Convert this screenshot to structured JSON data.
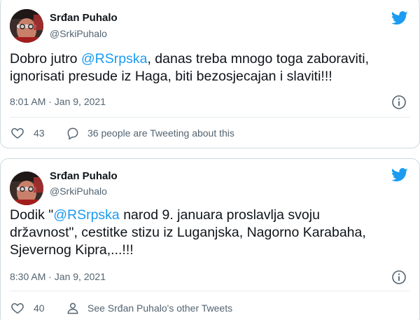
{
  "tweets": [
    {
      "author_name": "Srđan Puhalo",
      "author_handle": "@SrkiPuhalo",
      "text_line1_prefix": "Dobro jutro ",
      "text_line1_mention": "@RSrpska",
      "text_line1_suffix": ", danas treba mnogo toga zaboraviti,",
      "text_line2": "ignorisati presude iz Haga, biti bezosjecajan i slaviti!!!",
      "timestamp": "8:01 AM · Jan 9, 2021",
      "like_count": "43",
      "secondary_action": "36 people are Tweeting about this"
    },
    {
      "author_name": "Srđan Puhalo",
      "author_handle": "@SrkiPuhalo",
      "text_line1_prefix": "Dodik \"",
      "text_line1_mention": "@RSrpska",
      "text_line1_suffix": " narod 9. januara proslavlja svoju",
      "text_line2": "državnost\", cestitke stizu iz Luganjska, Nagorno Karabaha,",
      "text_line3": "Sjevernog Kipra,...!!!",
      "timestamp": "8:30 AM · Jan 9, 2021",
      "like_count": "40",
      "secondary_action": "See Srđan Puhalo's other Tweets"
    }
  ],
  "icons": {
    "brand": "twitter-bird-icon",
    "info": "info-icon",
    "like": "heart-icon",
    "reply": "speech-bubble-icon",
    "profile": "person-icon"
  },
  "colors": {
    "accent": "#1d9bf0",
    "muted": "#536471",
    "border": "#cfd9de"
  }
}
